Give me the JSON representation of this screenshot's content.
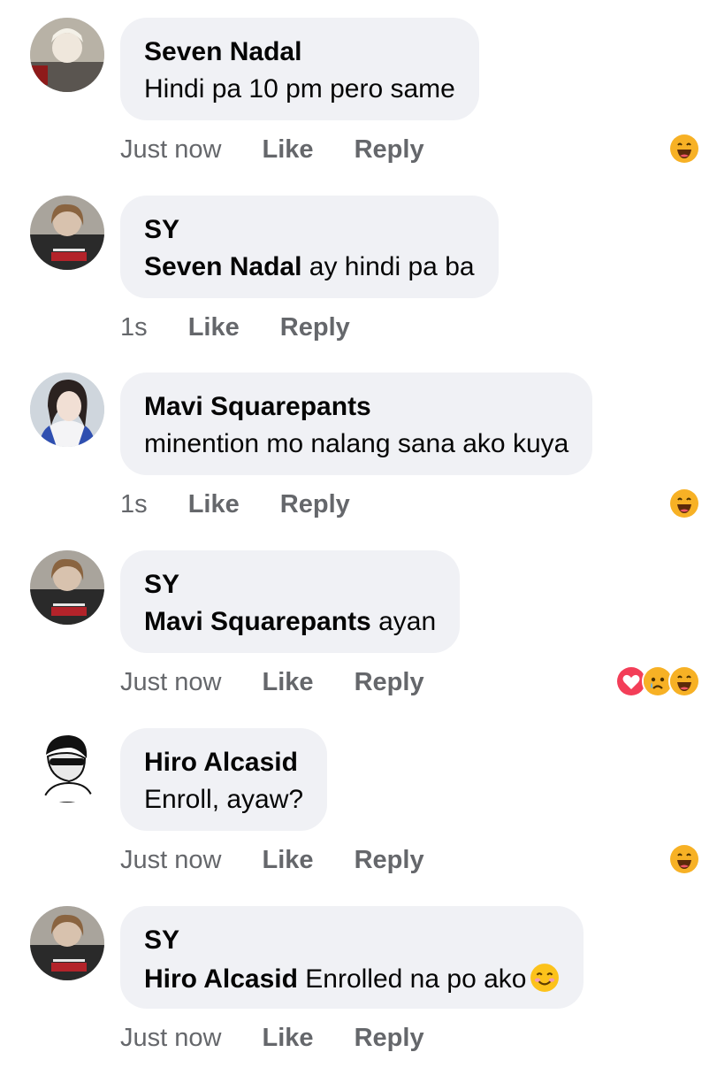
{
  "comments": [
    {
      "author": "Seven Nadal",
      "mention": "",
      "text": "Hindi pa 10 pm pero same",
      "time": "Just now",
      "like_label": "Like",
      "reply_label": "Reply",
      "reactions": [
        "haha-icon"
      ]
    },
    {
      "author": "SY",
      "mention": "Seven Nadal",
      "text": " ay hindi pa ba",
      "time": "1s",
      "like_label": "Like",
      "reply_label": "Reply",
      "reactions": []
    },
    {
      "author": "Mavi Squarepants",
      "mention": "",
      "text": "minention mo nalang sana ako kuya",
      "time": "1s",
      "like_label": "Like",
      "reply_label": "Reply",
      "reactions": [
        "haha-icon"
      ]
    },
    {
      "author": "SY",
      "mention": "Mavi Squarepants",
      "text": " ayan",
      "time": "Just now",
      "like_label": "Like",
      "reply_label": "Reply",
      "reactions": [
        "love-icon",
        "sad-icon",
        "haha-icon"
      ]
    },
    {
      "author": "Hiro Alcasid",
      "mention": "",
      "text": "Enroll, ayaw?",
      "time": "Just now",
      "like_label": "Like",
      "reply_label": "Reply",
      "reactions": [
        "haha-icon"
      ]
    },
    {
      "author": "SY",
      "mention": "Hiro Alcasid",
      "text": " Enrolled na po ako",
      "time": "Just now",
      "like_label": "Like",
      "reply_label": "Reply",
      "reactions": [],
      "trailing_emoji": "smiling-face-emoji"
    }
  ],
  "colors": {
    "bubble": "#f0f1f5",
    "text": "#050505",
    "meta": "#65676b",
    "haha": "#f7b125",
    "love": "#f33e58"
  }
}
